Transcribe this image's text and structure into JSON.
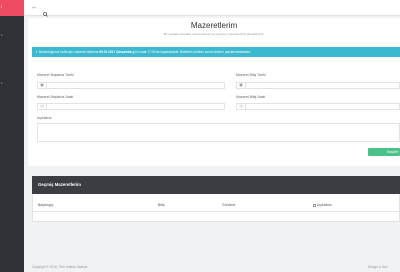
{
  "sidebar": {
    "brand": "i",
    "items": [
      "k",
      "li"
    ]
  },
  "topbar": {
    "back_icon": "arrow-left-icon",
    "search_icon": "search-icon"
  },
  "page": {
    "title": "Mazeretlerim",
    "subtitle": "Bu sayfada öncelikle mazeretlerinizi ve geçmiş mazeretlerinizi görebilirsiniz."
  },
  "alert": {
    "prefix": "Bulunduğunuz hafta için mazeret eklenme",
    "date": "09.01.2017 Çarşamba",
    "suffix": "günü saat 17:00'da kapanacaktır. Belirtilen tarihten sonra ekleme yapılamamaktadır."
  },
  "form": {
    "start_date_label": "Mazeret Başlama Tarihi",
    "end_date_label": "Mazeret Bitiş Tarihi",
    "start_time_label": "Mazeret Başlama Saati",
    "end_time_label": "Mazeret Bitiş Saati",
    "description_label": "Açıklama",
    "submit_label": "Kaydet"
  },
  "history": {
    "title": "Geçmiş Mazeretlerim",
    "columns": [
      "Başlangıç",
      "Bitiş",
      "Gönüme",
      "Açıklama"
    ]
  },
  "footer": {
    "left": "Copyright © 2016. Tüm Hakları Saklıdır.",
    "right": "Design & Dev"
  }
}
